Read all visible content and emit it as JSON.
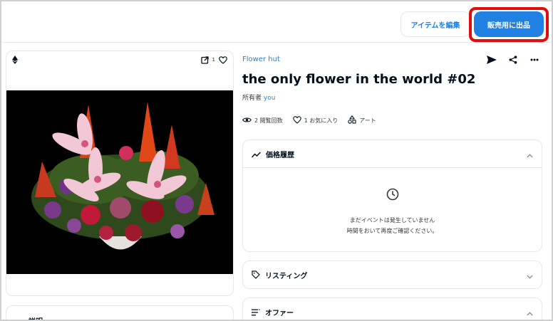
{
  "header": {
    "edit_button": "アイテムを編集",
    "sell_button": "販売用に出品"
  },
  "image_card": {
    "chain_icon": "ethereum-icon",
    "favorite_count": "1"
  },
  "description": {
    "label": "説明"
  },
  "item": {
    "collection": "Flower hut",
    "title": "the only flower in the world #02",
    "owner_prefix": "所有者",
    "owner_name": "you"
  },
  "stats": {
    "views": "2 閲覧回数",
    "favorites": "1 お気に入り",
    "category": "アート"
  },
  "price_history": {
    "title": "価格履歴",
    "empty_line_1": "まだイベントは発生していません",
    "empty_line_2": "時間をおいて再度ご確認ください。"
  },
  "listings": {
    "title": "リスティング"
  },
  "offers": {
    "title": "オファー"
  },
  "colors": {
    "accent": "#2081e2",
    "highlight": "#e10e0e",
    "text": "#04111d"
  }
}
